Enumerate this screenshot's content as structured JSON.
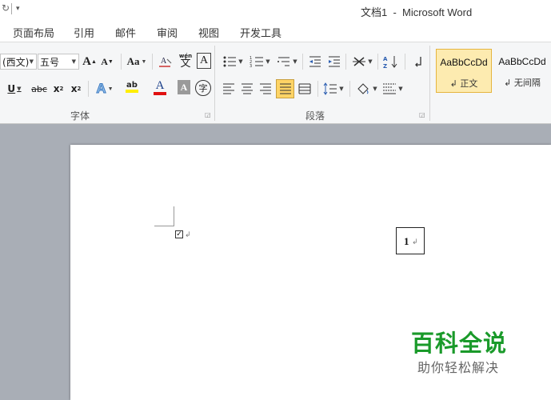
{
  "window": {
    "title": "文档1  -  Microsoft Word",
    "quick_access": {
      "undo_glyph": "↻",
      "more_glyph": "▾"
    }
  },
  "menu": {
    "tabs": [
      "页面布局",
      "引用",
      "邮件",
      "审阅",
      "视图",
      "开发工具"
    ]
  },
  "ribbon": {
    "font": {
      "font_name": "(西文)",
      "font_size": "五号",
      "grow": "A",
      "shrink": "A",
      "change_case": "Aa",
      "clear_format": "A",
      "phonetic": "wén",
      "phonetic_char": "文",
      "char_border": "A",
      "underline": "U",
      "strike": "abc",
      "subscript": "x",
      "superscript": "x",
      "sub_mark": "2",
      "sup_mark": "2",
      "text_effect": "A",
      "highlight": "ab",
      "font_color": "A",
      "char_shade": "A",
      "enclose_char": "字",
      "group_label": "字体"
    },
    "paragraph": {
      "group_label": "段落"
    },
    "styles": [
      {
        "sample": "AaBbCcDd",
        "name": "↲ 正文"
      },
      {
        "sample": "AaBbCcDd",
        "name": "↲ 无间隔"
      }
    ],
    "colors": {
      "highlight": "#ffee00",
      "font_color": "#e01010",
      "selected": "#ffd466"
    }
  },
  "document": {
    "checkbox_glyph": "✓",
    "para_mark": "↲",
    "textbox_text": "1"
  },
  "watermark": {
    "brand": "百科全说",
    "tagline": "助你轻松解决",
    "color": "#1a9a2a"
  }
}
